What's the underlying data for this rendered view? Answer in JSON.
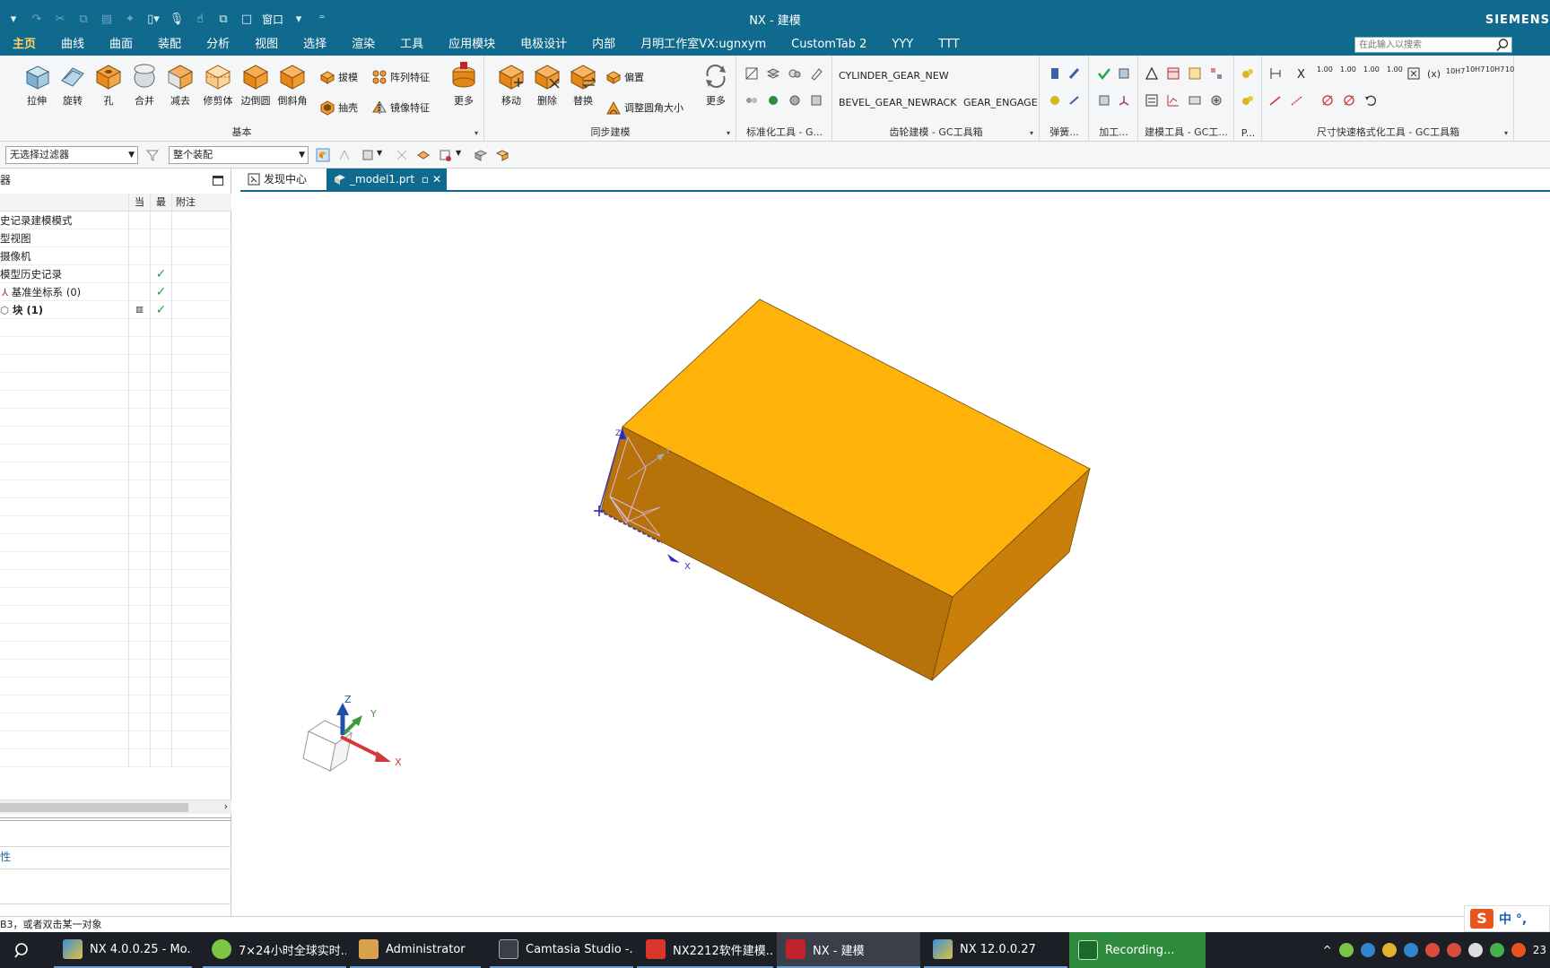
{
  "window": {
    "title": "NX - 建模",
    "brand": "SIEMENS",
    "qat_window_label": "窗口"
  },
  "menu_tabs": [
    "主页",
    "曲线",
    "曲面",
    "装配",
    "分析",
    "视图",
    "选择",
    "渲染",
    "工具",
    "应用模块",
    "电极设计",
    "内部",
    "月明工作室VX:ugnxym",
    "CustomTab 2",
    "YYY",
    "TTT"
  ],
  "search": {
    "placeholder": "在此输入以搜索"
  },
  "ribbon": {
    "basic": {
      "label": "基本",
      "buttons": [
        "拉伸",
        "旋转",
        "孔",
        "合并",
        "减去",
        "修剪体",
        "边倒圆",
        "倒斜角"
      ],
      "small": [
        "拔模",
        "阵列特征",
        "抽壳",
        "镜像特征"
      ],
      "more": "更多"
    },
    "sync": {
      "label": "同步建模",
      "buttons": [
        "移动",
        "删除",
        "替换"
      ],
      "small": [
        "偏置",
        "调整圆角大小"
      ],
      "more": "更多"
    },
    "standard": {
      "label": "标准化工具 - G..."
    },
    "gear": {
      "label": "齿轮建模 - GC工具箱",
      "items": [
        "CYLINDER_GEAR_NEW",
        "BEVEL_GEAR_NEW",
        "RACK",
        "GEAR_ENGAGE"
      ]
    },
    "spring": {
      "label": "弹簧..."
    },
    "machining": {
      "label": "加工..."
    },
    "modeling_tools": {
      "label": "建模工具 - GC工..."
    },
    "p": {
      "label": "P..."
    },
    "dim": {
      "label": "尺寸快速格式化工具 - GC工具箱",
      "items": [
        "X",
        "1.00",
        "1.00",
        "1.00",
        "1.00",
        "10H7",
        "10H7",
        "10H7",
        "10"
      ]
    }
  },
  "selection_bar": {
    "filter": "无选择过滤器",
    "scope": "整个装配"
  },
  "navigator": {
    "title": "器",
    "headers": {
      "name": "",
      "current": "当",
      "latest": "最",
      "note": "附注"
    },
    "rows": [
      {
        "name": "史记录建模模式",
        "latest": ""
      },
      {
        "name": "型视图",
        "latest": ""
      },
      {
        "name": "摄像机",
        "latest": ""
      },
      {
        "name": "模型历史记录",
        "latest": "✓"
      },
      {
        "name": "基准坐标系 (0)",
        "latest": "✓"
      },
      {
        "name": "块 (1)",
        "latest": "✓"
      }
    ],
    "detail_label": "性"
  },
  "doc_tabs": [
    {
      "label": "发现中心"
    },
    {
      "label": "_model1.prt"
    }
  ],
  "viewport": {
    "triad": {
      "x": "X",
      "y": "Y",
      "z": "Z"
    },
    "wcs": {
      "x": "X",
      "y": "Y",
      "z": "Z"
    },
    "colors": {
      "top": "#ffb20a",
      "front": "#b8720a",
      "right": "#c97f0a"
    }
  },
  "status": {
    "text": "B3，或者双击某一对象"
  },
  "ime": {
    "text": "中 °,"
  },
  "taskbar": {
    "tasks": [
      "NX 4.0.0.25 - Mo...",
      "7×24小时全球实时...",
      "Administrator",
      "Camtasia Studio -...",
      "NX2212软件建模...",
      "NX - 建模",
      "NX 12.0.0.27",
      "Recording..."
    ],
    "clock": "23"
  }
}
